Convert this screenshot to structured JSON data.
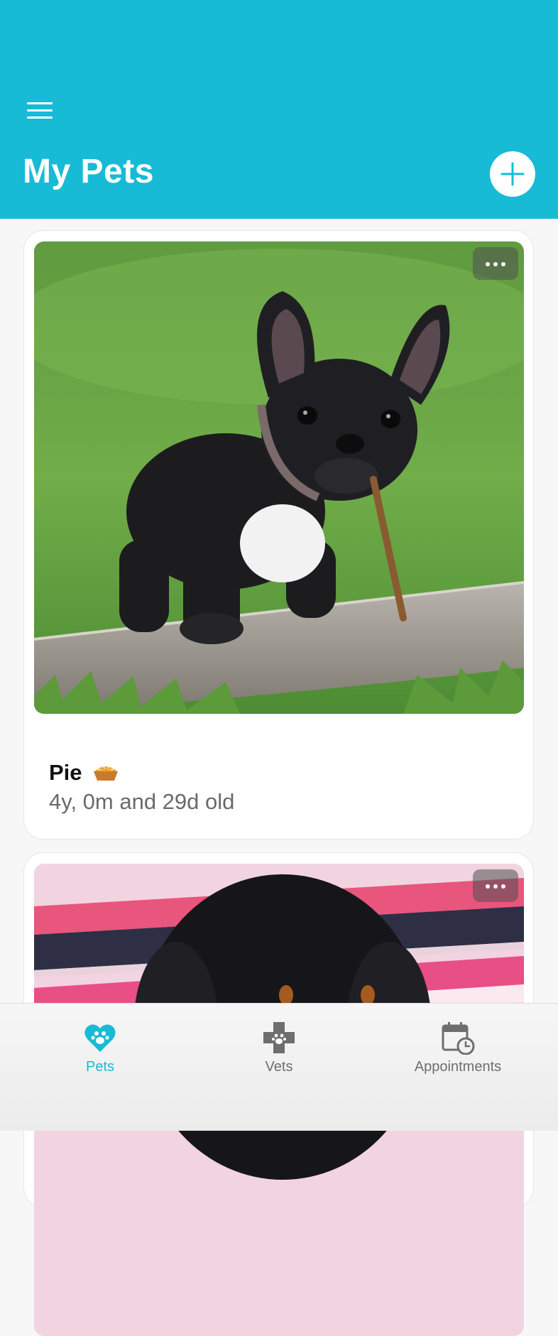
{
  "header": {
    "title": "My Pets"
  },
  "pets": [
    {
      "name": "Pie",
      "emoji": "pie-icon",
      "age": "4y, 0m and 29d old"
    },
    {
      "name": "",
      "age": ""
    }
  ],
  "tabs": [
    {
      "label": "Pets",
      "icon": "paw-heart-icon",
      "active": true
    },
    {
      "label": "Vets",
      "icon": "medical-cross-icon",
      "active": false
    },
    {
      "label": "Appointments",
      "icon": "calendar-clock-icon",
      "active": false
    }
  ],
  "colors": {
    "accent": "#17bbd5",
    "inactive": "#6e6e6e"
  }
}
